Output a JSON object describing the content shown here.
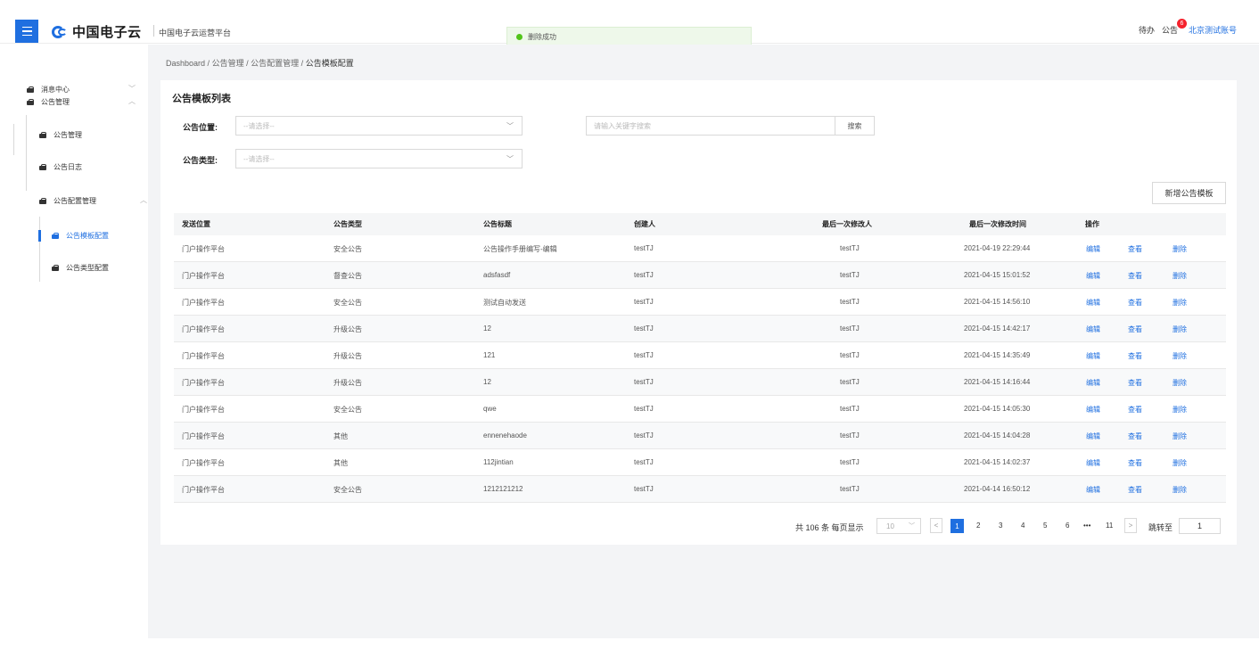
{
  "header": {
    "logo_text": "中国电子云",
    "platform_name": "中国电子云运营平台",
    "toast_text": "删除成功",
    "todo_label": "待办",
    "notice_label": "公告",
    "notice_count": "6",
    "account_name": "北京测试账号"
  },
  "sidebar": {
    "items": [
      {
        "label": "消息中心"
      },
      {
        "label": "公告管理"
      },
      {
        "label": "公告管理"
      },
      {
        "label": "公告日志"
      },
      {
        "label": "公告配置管理"
      },
      {
        "label": "公告模板配置"
      },
      {
        "label": "公告类型配置"
      }
    ],
    "chevrons": {
      "down": "﹀",
      "up": "︿"
    }
  },
  "breadcrumb": {
    "items": [
      "Dashboard",
      "公告管理",
      "公告配置管理",
      "公告模板配置"
    ],
    "separator": "/"
  },
  "page_title": "公告模板列表",
  "filters": {
    "position_label": "公告位置:",
    "position_placeholder": "--请选择--",
    "type_label": "公告类型:",
    "type_placeholder": "--请选择--",
    "search_placeholder": "请输入关键字搜索",
    "search_button": "搜索"
  },
  "add_button": "新增公告模板",
  "table": {
    "columns": [
      "发送位置",
      "公告类型",
      "公告标题",
      "创建人",
      "最后一次修改人",
      "最后一次修改时间",
      "操作"
    ],
    "actions": [
      "编辑",
      "查看",
      "删除"
    ],
    "rows": [
      [
        "门户操作平台",
        "安全公告",
        "公告操作手册编写-编辑",
        "testTJ",
        "testTJ",
        "2021-04-19 22:29:44"
      ],
      [
        "门户操作平台",
        "督查公告",
        "adsfasdf",
        "testTJ",
        "testTJ",
        "2021-04-15 15:01:52"
      ],
      [
        "门户操作平台",
        "安全公告",
        "测试自动发送",
        "testTJ",
        "testTJ",
        "2021-04-15 14:56:10"
      ],
      [
        "门户操作平台",
        "升级公告",
        "12",
        "testTJ",
        "testTJ",
        "2021-04-15 14:42:17"
      ],
      [
        "门户操作平台",
        "升级公告",
        "121",
        "testTJ",
        "testTJ",
        "2021-04-15 14:35:49"
      ],
      [
        "门户操作平台",
        "升级公告",
        "12",
        "testTJ",
        "testTJ",
        "2021-04-15 14:16:44"
      ],
      [
        "门户操作平台",
        "安全公告",
        "qwe",
        "testTJ",
        "testTJ",
        "2021-04-15 14:05:30"
      ],
      [
        "门户操作平台",
        "其他",
        "ennenehaode",
        "testTJ",
        "testTJ",
        "2021-04-15 14:04:28"
      ],
      [
        "门户操作平台",
        "其他",
        "112jintian",
        "testTJ",
        "testTJ",
        "2021-04-15 14:02:37"
      ],
      [
        "门户操作平台",
        "安全公告",
        "1212121212",
        "testTJ",
        "testTJ",
        "2021-04-14 16:50:12"
      ]
    ]
  },
  "pagination": {
    "total_text": "共 106 条",
    "per_page_label": "每页显示",
    "per_page_value": "10",
    "prev": "<",
    "next": ">",
    "current": "1",
    "pages": [
      "2",
      "3",
      "4",
      "5",
      "6",
      "•••",
      "11"
    ],
    "jump_label": "跳转至",
    "jump_value": "1"
  }
}
